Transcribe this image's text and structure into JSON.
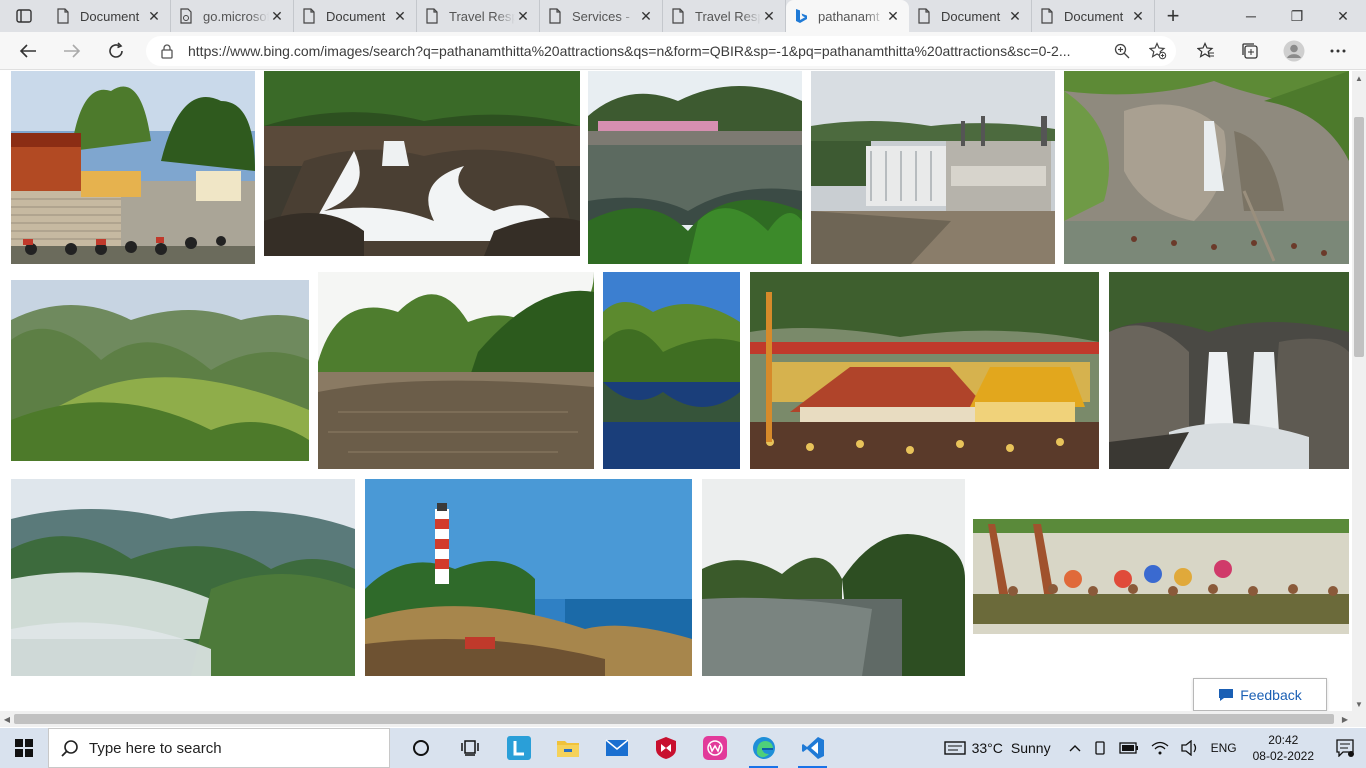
{
  "browser": {
    "tabs": [
      {
        "title": "Document",
        "icon": "page-icon",
        "active": false,
        "faded": false
      },
      {
        "title": "go.microsoft",
        "icon": "link-page-icon",
        "active": false,
        "faded": true
      },
      {
        "title": "Document",
        "icon": "page-icon",
        "active": false,
        "faded": false
      },
      {
        "title": "Travel Resp",
        "icon": "page-icon",
        "active": false,
        "faded": true
      },
      {
        "title": "Services - ",
        "icon": "page-icon",
        "active": false,
        "faded": true
      },
      {
        "title": "Travel Resp",
        "icon": "page-icon",
        "active": false,
        "faded": true
      },
      {
        "title": "pathanamt",
        "icon": "bing-icon",
        "active": true,
        "faded": true
      },
      {
        "title": "Document",
        "icon": "page-icon",
        "active": false,
        "faded": false
      },
      {
        "title": "Document",
        "icon": "page-icon",
        "active": false,
        "faded": false
      }
    ],
    "new_tab_symbol": "+",
    "window_controls": {
      "minimize": "─",
      "restore": "❐",
      "close": "✕"
    },
    "address_url": "https://www.bing.com/images/search?q=pathanamthitta%20attractions&qs=n&form=QBIR&sp=-1&pq=pathanamthitta%20attractions&sc=0-2...",
    "toolbar_icons": [
      "back-arrow-icon",
      "forward-arrow-icon",
      "refresh-icon",
      "lock-icon",
      "zoom-icon",
      "add-favorite-icon",
      "favorites-icon",
      "collections-icon",
      "profile-icon",
      "more-icon"
    ]
  },
  "results": {
    "images": [
      {
        "row": 1,
        "subject": "temple-steps"
      },
      {
        "row": 1,
        "subject": "rocky-waterfall"
      },
      {
        "row": 1,
        "subject": "river-village"
      },
      {
        "row": 1,
        "subject": "dam-spillway"
      },
      {
        "row": 1,
        "subject": "cascade-bathers"
      },
      {
        "row": 2,
        "subject": "green-hills"
      },
      {
        "row": 2,
        "subject": "forest-river"
      },
      {
        "row": 2,
        "subject": "lake-reflection"
      },
      {
        "row": 2,
        "subject": "sabarimala-temple"
      },
      {
        "row": 2,
        "subject": "gorge-waterfall"
      },
      {
        "row": 3,
        "subject": "misty-mountains"
      },
      {
        "row": 3,
        "subject": "lighthouse-coast"
      },
      {
        "row": 3,
        "subject": "calm-river"
      },
      {
        "row": 3,
        "subject": "snake-boat-race"
      }
    ],
    "feedback_label": "Feedback"
  },
  "taskbar": {
    "search_placeholder": "Type here to search",
    "apps": [
      "cortana-icon",
      "task-view-icon",
      "l-app-icon",
      "file-explorer-icon",
      "mail-icon",
      "mcafee-icon",
      "w-app-icon",
      "edge-icon",
      "vscode-icon"
    ],
    "weather": {
      "temp": "33°C",
      "condition": "Sunny"
    },
    "language": "ENG",
    "time": "20:42",
    "date": "08-02-2022"
  },
  "colors": {
    "tabstrip": "#dfe1e5",
    "toolbar": "#f7f7f7",
    "taskbar": "#d9e2ee",
    "feedback_text": "#1a5fb4",
    "accent": "#1a73e8"
  }
}
